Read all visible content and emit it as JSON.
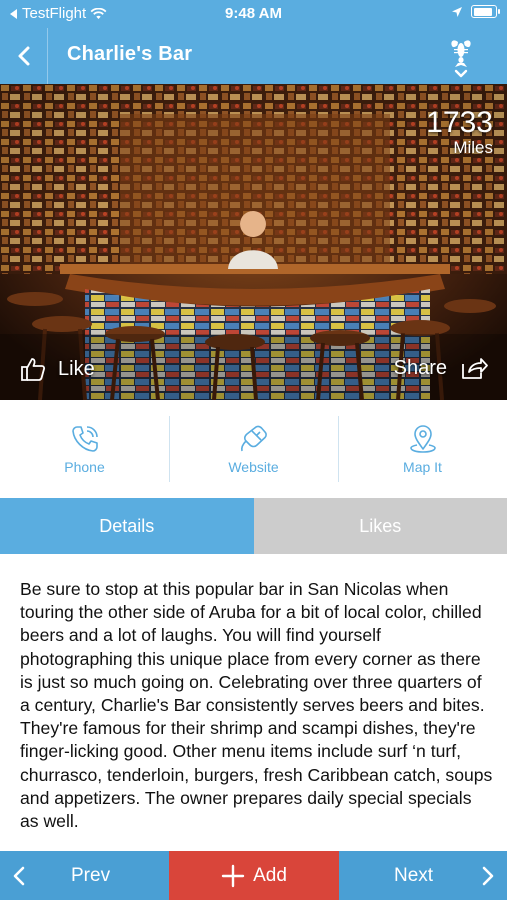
{
  "status_bar": {
    "back_app": "TestFlight",
    "time": "9:48 AM"
  },
  "nav": {
    "title": "Charlie's Bar",
    "back_icon": "chevron-left-icon",
    "logo_icon": "lobster-icon"
  },
  "hero": {
    "distance_value": "1733",
    "distance_unit": "Miles",
    "like_label": "Like",
    "share_label": "Share"
  },
  "actions": [
    {
      "label": "Phone",
      "icon": "phone-icon"
    },
    {
      "label": "Website",
      "icon": "mouse-icon"
    },
    {
      "label": "Map It",
      "icon": "map-pin-icon"
    }
  ],
  "tabs": [
    {
      "label": "Details",
      "active": true
    },
    {
      "label": "Likes",
      "active": false
    }
  ],
  "description": "Be sure to stop at this popular bar in San Nicolas when touring the other side of Aruba for a bit of local color, chilled beers and a lot of laughs. You will find yourself photographing this unique place from every corner as there is just so much going on. Celebrating over three quarters of a century, Charlie's Bar consistently serves beers and bites. They're famous for their shrimp and scampi dishes, they're finger-licking good. Other menu items include surf ‘n turf, churrasco, tenderloin, burgers, fresh Caribbean catch, soups and appetizers. The owner prepares daily special specials as well.",
  "bottom_bar": {
    "prev_label": "Prev",
    "add_label": "Add",
    "next_label": "Next"
  },
  "colors": {
    "primary": "#5aade0",
    "bottom_bar": "#4a9fd4",
    "add_button": "#d9453a",
    "inactive_tab": "#cccccc"
  }
}
